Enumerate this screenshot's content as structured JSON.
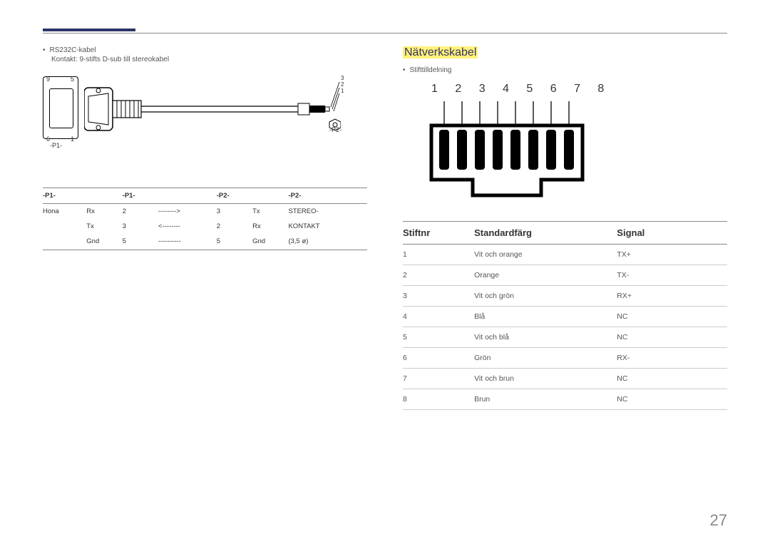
{
  "page_number": "27",
  "left": {
    "bullet": "RS232C-kabel",
    "subline": "Kontakt: 9-stifts D-sub till stereokabel",
    "p1_labels": {
      "tl": "9",
      "tr": "5",
      "bl": "6",
      "br": "1",
      "name": "-P1-"
    },
    "p2_labels": {
      "pins": "3\n2\n1",
      "name": "-P2-"
    },
    "table_headers": [
      "-P1-",
      "",
      "-P1-",
      "",
      "-P2-",
      "",
      "-P2-"
    ],
    "table_rows": [
      [
        "Hona",
        "Rx",
        "2",
        "-------->",
        "3",
        "Tx",
        "STEREO-"
      ],
      [
        "",
        "Tx",
        "3",
        "<--------",
        "2",
        "Rx",
        "KONTAKT"
      ],
      [
        "",
        "Gnd",
        "5",
        "----------",
        "5",
        "Gnd",
        "(3,5 ø)"
      ]
    ]
  },
  "right": {
    "heading": "Nätverkskabel",
    "bullet": "Stifttilldelning",
    "pin_numbers": "1 2 3 4 5 6 7 8",
    "table_headers": [
      "Stiftnr",
      "Standardfärg",
      "Signal"
    ],
    "table_rows": [
      [
        "1",
        "Vit och orange",
        "TX+"
      ],
      [
        "2",
        "Orange",
        "TX-"
      ],
      [
        "3",
        "Vit och grön",
        "RX+"
      ],
      [
        "4",
        "Blå",
        "NC"
      ],
      [
        "5",
        "Vit och blå",
        "NC"
      ],
      [
        "6",
        "Grön",
        "RX-"
      ],
      [
        "7",
        "Vit och brun",
        "NC"
      ],
      [
        "8",
        "Brun",
        "NC"
      ]
    ]
  }
}
